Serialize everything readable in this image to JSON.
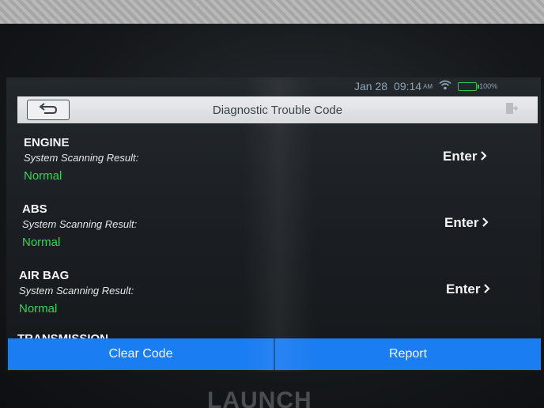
{
  "status": {
    "date": "Jan 28",
    "time": "09:14",
    "ampm": "AM",
    "battery": "100%",
    "battery_level": 1.0
  },
  "header": {
    "title": "Diagnostic Trouble Code"
  },
  "systems": [
    {
      "name": "ENGINE",
      "result_label": "System Scanning Result:",
      "status": "Normal",
      "enter_label": "Enter"
    },
    {
      "name": "ABS",
      "result_label": "System Scanning Result:",
      "status": "Normal",
      "enter_label": "Enter"
    },
    {
      "name": "AIR BAG",
      "result_label": "System Scanning Result:",
      "status": "Normal",
      "enter_label": "Enter"
    }
  ],
  "partial_system": "TRANSMISSION",
  "footer": {
    "clear_code_label": "Clear Code",
    "report_label": "Report"
  },
  "brand": "LAUNCH",
  "colors": {
    "accent": "#1b7df2",
    "status_normal": "#39d25a",
    "battery": "#37c15a"
  }
}
